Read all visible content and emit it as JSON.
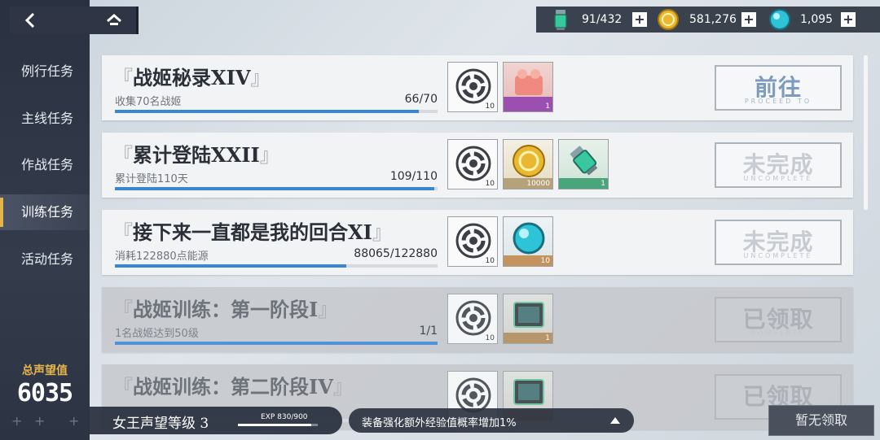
{
  "sidebar": {
    "items": [
      {
        "label": "例行任务"
      },
      {
        "label": "主线任务"
      },
      {
        "label": "作战任务"
      },
      {
        "label": "训练任务"
      },
      {
        "label": "活动任务"
      }
    ],
    "active_index": 3,
    "reputation_label": "总声望值",
    "reputation_value": "6035"
  },
  "resources": [
    {
      "icon": "energy-canister-icon",
      "value": "91/432"
    },
    {
      "icon": "gold-coin-icon",
      "value": "581,276"
    },
    {
      "icon": "crystal-orb-icon",
      "value": "1,095"
    }
  ],
  "tasks": [
    {
      "title_open": "『",
      "title": "战姬秘录XIV",
      "title_close": "』",
      "desc": "收集70名战姬",
      "progress": "66/70",
      "progress_fraction": 0.943,
      "rewards": [
        {
          "icon": "emblem-icon",
          "qty": "10"
        },
        {
          "icon": "pink-gift-icon",
          "qty": "1"
        }
      ],
      "status_main": "前往",
      "status_sub": "PROCEED TO",
      "state": "go"
    },
    {
      "title_open": "『",
      "title": "累计登陆XXII",
      "title_close": "』",
      "desc": "累计登陆110天",
      "progress": "109/110",
      "progress_fraction": 0.991,
      "rewards": [
        {
          "icon": "emblem-icon",
          "qty": "10"
        },
        {
          "icon": "gold-coin-icon",
          "qty": "10000"
        },
        {
          "icon": "energy-canister-icon",
          "qty": "1"
        }
      ],
      "status_main": "未完成",
      "status_sub": "UNCOMPLETE",
      "state": "incomplete"
    },
    {
      "title_open": "『",
      "title": "接下来一直都是我的回合XI",
      "title_close": "』",
      "desc": "消耗122880点能源",
      "progress": "88065/122880",
      "progress_fraction": 0.717,
      "rewards": [
        {
          "icon": "emblem-icon",
          "qty": "10"
        },
        {
          "icon": "crystal-orb-icon",
          "qty": "10"
        }
      ],
      "status_main": "未完成",
      "status_sub": "UNCOMPLETE",
      "state": "incomplete"
    },
    {
      "title_open": "『",
      "title": "战姬训练：第一阶段I",
      "title_close": "』",
      "desc": "1名战姬达到50级",
      "progress": "1/1",
      "progress_fraction": 1.0,
      "rewards": [
        {
          "icon": "emblem-icon",
          "qty": "10"
        },
        {
          "icon": "tablet-icon",
          "qty": "1"
        }
      ],
      "status_main": "已领取",
      "status_sub": "COMPLETE",
      "state": "done"
    },
    {
      "title_open": "『",
      "title": "战姬训练：第二阶段IV",
      "title_close": "』",
      "desc": "",
      "progress": "",
      "progress_fraction": 0,
      "rewards": [
        {
          "icon": "emblem-icon",
          "qty": ""
        },
        {
          "icon": "tablet-icon",
          "qty": ""
        }
      ],
      "status_main": "已领取",
      "status_sub": "",
      "state": "done"
    }
  ],
  "footer": {
    "level_title": "女王声望等级 3",
    "exp_label": "EXP  830/900",
    "exp_fraction": 0.922,
    "bonus_text": "装备强化额外经验值概率增加1%",
    "claim_label": "暂无领取"
  }
}
